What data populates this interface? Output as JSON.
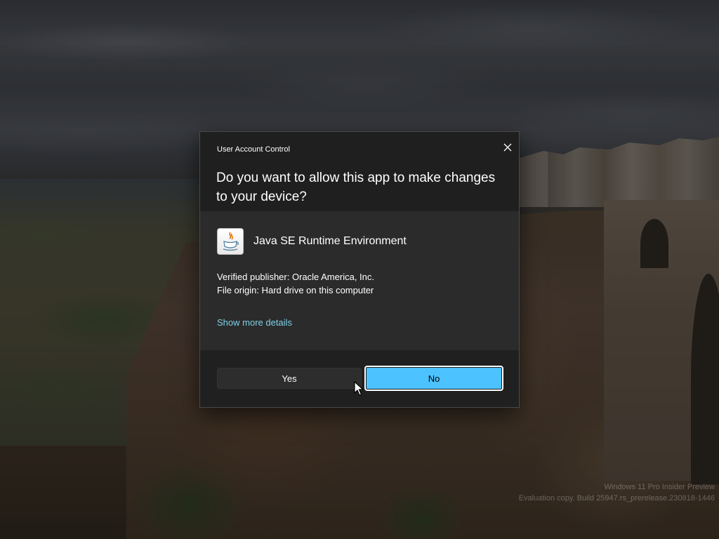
{
  "dialog": {
    "caption": "User Account Control",
    "question": "Do you want to allow this app to make changes to your device?",
    "close_icon": "close-icon",
    "app": {
      "name": "Java SE Runtime Environment",
      "icon": "java-icon"
    },
    "publisher": "Verified publisher: Oracle America, Inc.",
    "origin": "File origin: Hard drive on this computer",
    "details_link": "Show more details",
    "buttons": {
      "yes": "Yes",
      "no": "No"
    },
    "accent_color": "#4cc2ff",
    "link_color": "#7fd0e8"
  },
  "watermark": {
    "line1": "Windows 11 Pro Insider Preview",
    "line2": "Evaluation copy. Build 25947.rs_prerelease.230818-1446"
  }
}
